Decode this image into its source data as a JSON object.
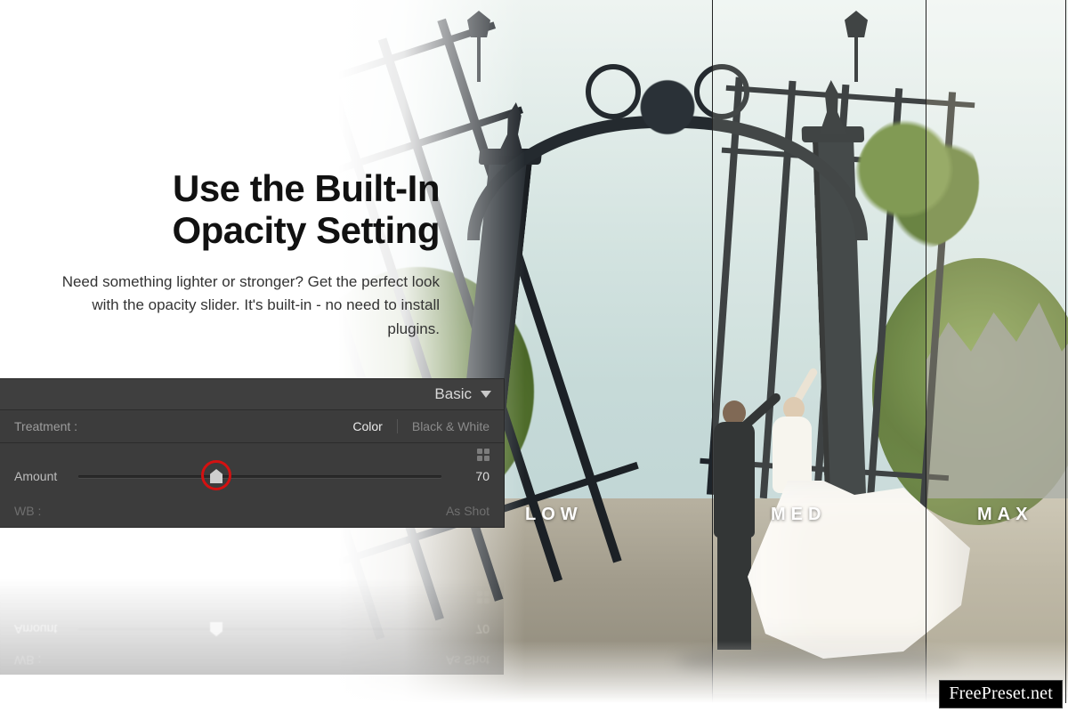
{
  "headline": {
    "line1": "Use the Built-In",
    "line2": "Opacity Setting"
  },
  "description": "Need something lighter or stronger? Get the perfect look with the opacity slider. It's built-in - no need to install plugins.",
  "panel": {
    "title": "Basic",
    "treatment_label": "Treatment :",
    "option_color": "Color",
    "option_bw": "Black & White",
    "amount_label": "Amount",
    "amount_value": "70",
    "wb_label": "WB :",
    "wb_value": "As Shot"
  },
  "compare": {
    "low": "LOW",
    "med": "MED",
    "max": "MAX"
  },
  "watermark": "FreePreset.net"
}
